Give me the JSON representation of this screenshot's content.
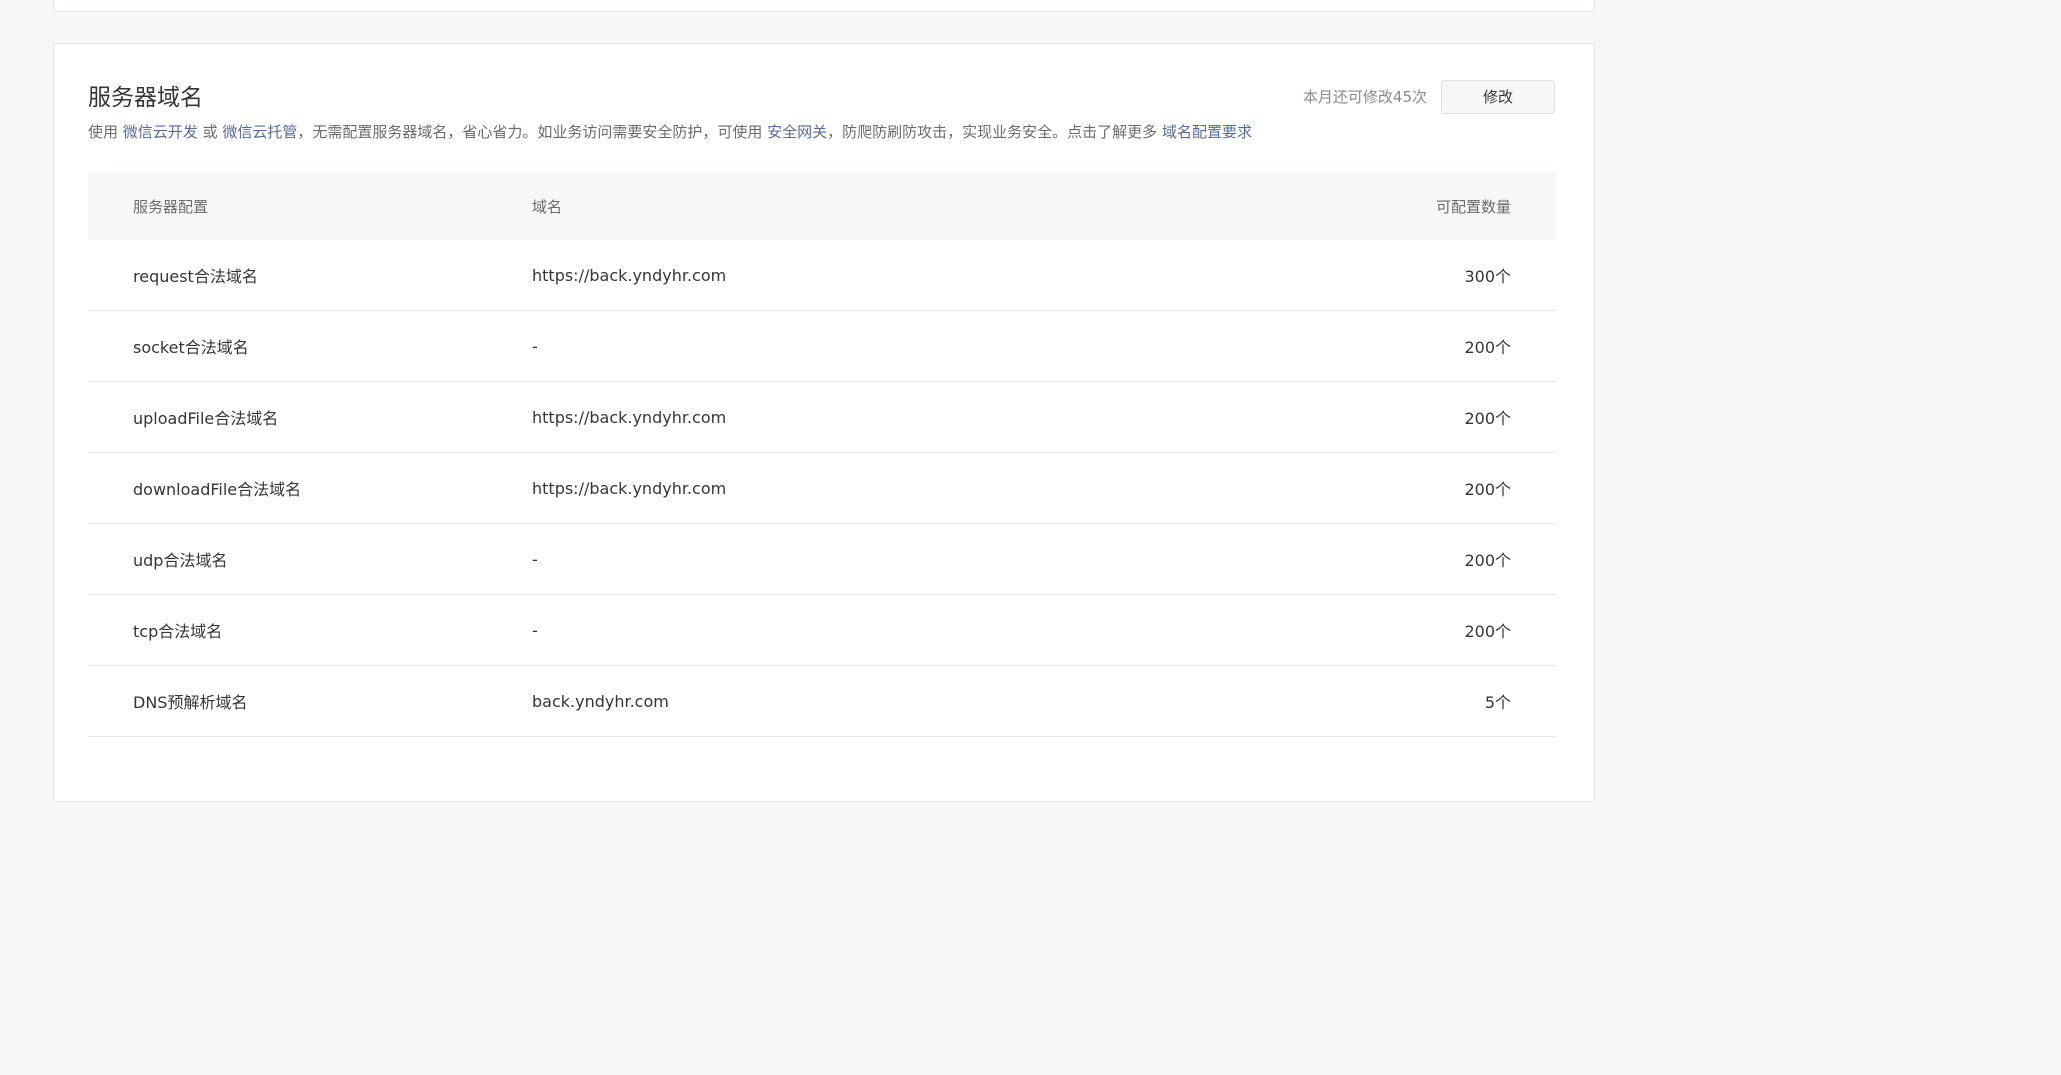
{
  "section": {
    "title": "服务器域名",
    "quota_text": "本月还可修改45次",
    "edit_button": "修改",
    "description": {
      "part1": "使用 ",
      "link1": "微信云开发",
      "part2": " 或 ",
      "link2": "微信云托管",
      "part3": "，无需配置服务器域名，省心省力。如业务访问需要安全防护，可使用 ",
      "link3": "安全网关",
      "part4": "，防爬防刷防攻击，实现业务安全。点击了解更多 ",
      "link4": "域名配置要求"
    }
  },
  "table": {
    "headers": [
      "服务器配置",
      "域名",
      "可配置数量"
    ],
    "rows": [
      [
        "request合法域名",
        "https://back.yndyhr.com",
        "300个"
      ],
      [
        "socket合法域名",
        "-",
        "200个"
      ],
      [
        "uploadFile合法域名",
        "https://back.yndyhr.com",
        "200个"
      ],
      [
        "downloadFile合法域名",
        "https://back.yndyhr.com",
        "200个"
      ],
      [
        "udp合法域名",
        "-",
        "200个"
      ],
      [
        "tcp合法域名",
        "-",
        "200个"
      ],
      [
        "DNS预解析域名",
        "back.yndyhr.com",
        "5个"
      ]
    ]
  }
}
